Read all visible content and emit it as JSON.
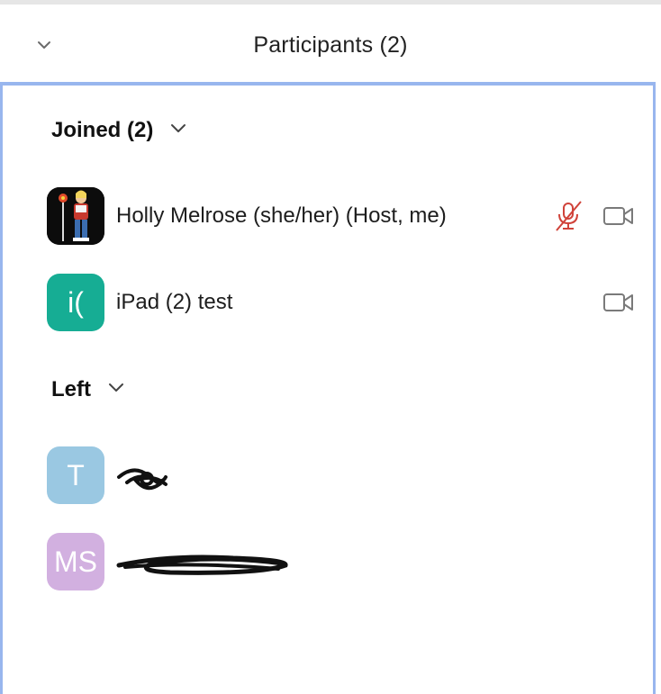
{
  "header": {
    "title": "Participants (2)"
  },
  "sections": {
    "joined": {
      "label": "Joined (2)"
    },
    "left": {
      "label": "Left"
    }
  },
  "joined": [
    {
      "name": "Holly Melrose (she/her) (Host, me)",
      "muted": true,
      "avatar": "photo"
    },
    {
      "name": "iPad (2) test",
      "initials": "i(",
      "avatar_color": "#16ad94"
    }
  ],
  "left": [
    {
      "initials": "T",
      "avatar_color": "#9ac8e2"
    },
    {
      "initials": "MS",
      "avatar_color": "#d2b0e0"
    }
  ],
  "colors": {
    "accent_border": "#98b6ee",
    "muted_red": "#d0433a",
    "icon_gray": "#7a7a7a"
  },
  "icons": {
    "collapse": "chevron-down-icon",
    "mic_muted": "mic-muted-icon",
    "camera": "video-camera-icon"
  }
}
